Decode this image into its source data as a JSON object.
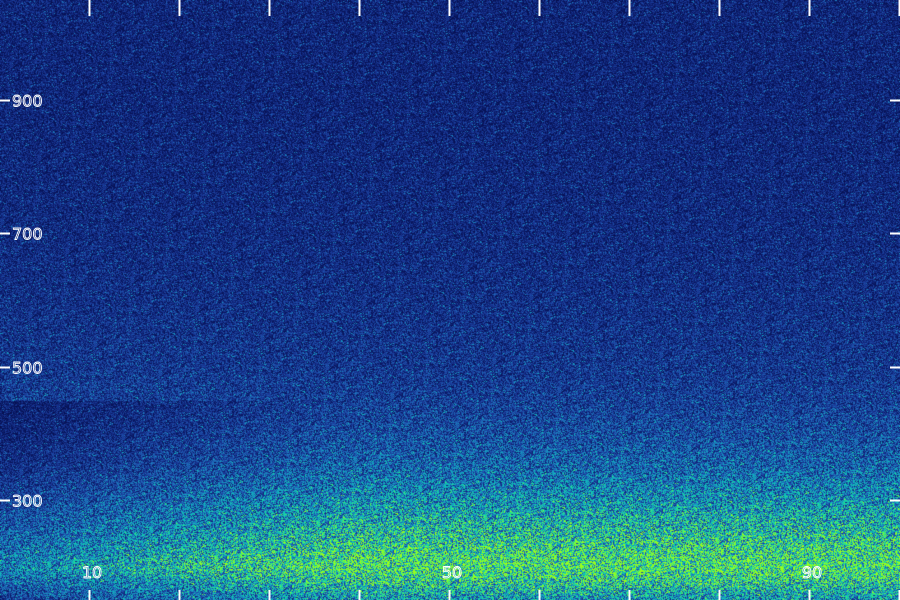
{
  "chart_data": {
    "type": "heatmap",
    "title": "",
    "xlabel": "",
    "ylabel": "",
    "xlim": [
      0,
      100
    ],
    "ylim": [
      150,
      1050
    ],
    "x_tick_labels": [
      {
        "value": 10,
        "label": "10"
      },
      {
        "value": 50,
        "label": "50"
      },
      {
        "value": 90,
        "label": "90"
      }
    ],
    "x_minor_ticks": [
      0,
      10,
      20,
      30,
      40,
      50,
      60,
      70,
      80,
      90,
      100
    ],
    "y_tick_labels": [
      {
        "value": 300,
        "label": "300"
      },
      {
        "value": 500,
        "label": "500"
      },
      {
        "value": 700,
        "label": "700"
      },
      {
        "value": 900,
        "label": "900"
      }
    ],
    "grid": false,
    "colormap": [
      "#000033",
      "#0a1a66",
      "#1a3a99",
      "#1f66b8",
      "#13a3c2",
      "#0fd0b0",
      "#3ff070",
      "#9cff1a"
    ],
    "intensity_profile": {
      "description_values": "relative intensity (0-1) by y value",
      "y": [
        150,
        200,
        250,
        300,
        350,
        400,
        450,
        500,
        600,
        700,
        800,
        900,
        1000,
        1050
      ],
      "intensity": [
        0.55,
        0.9,
        0.7,
        0.55,
        0.42,
        0.35,
        0.3,
        0.27,
        0.24,
        0.22,
        0.21,
        0.2,
        0.2,
        0.2
      ]
    }
  }
}
